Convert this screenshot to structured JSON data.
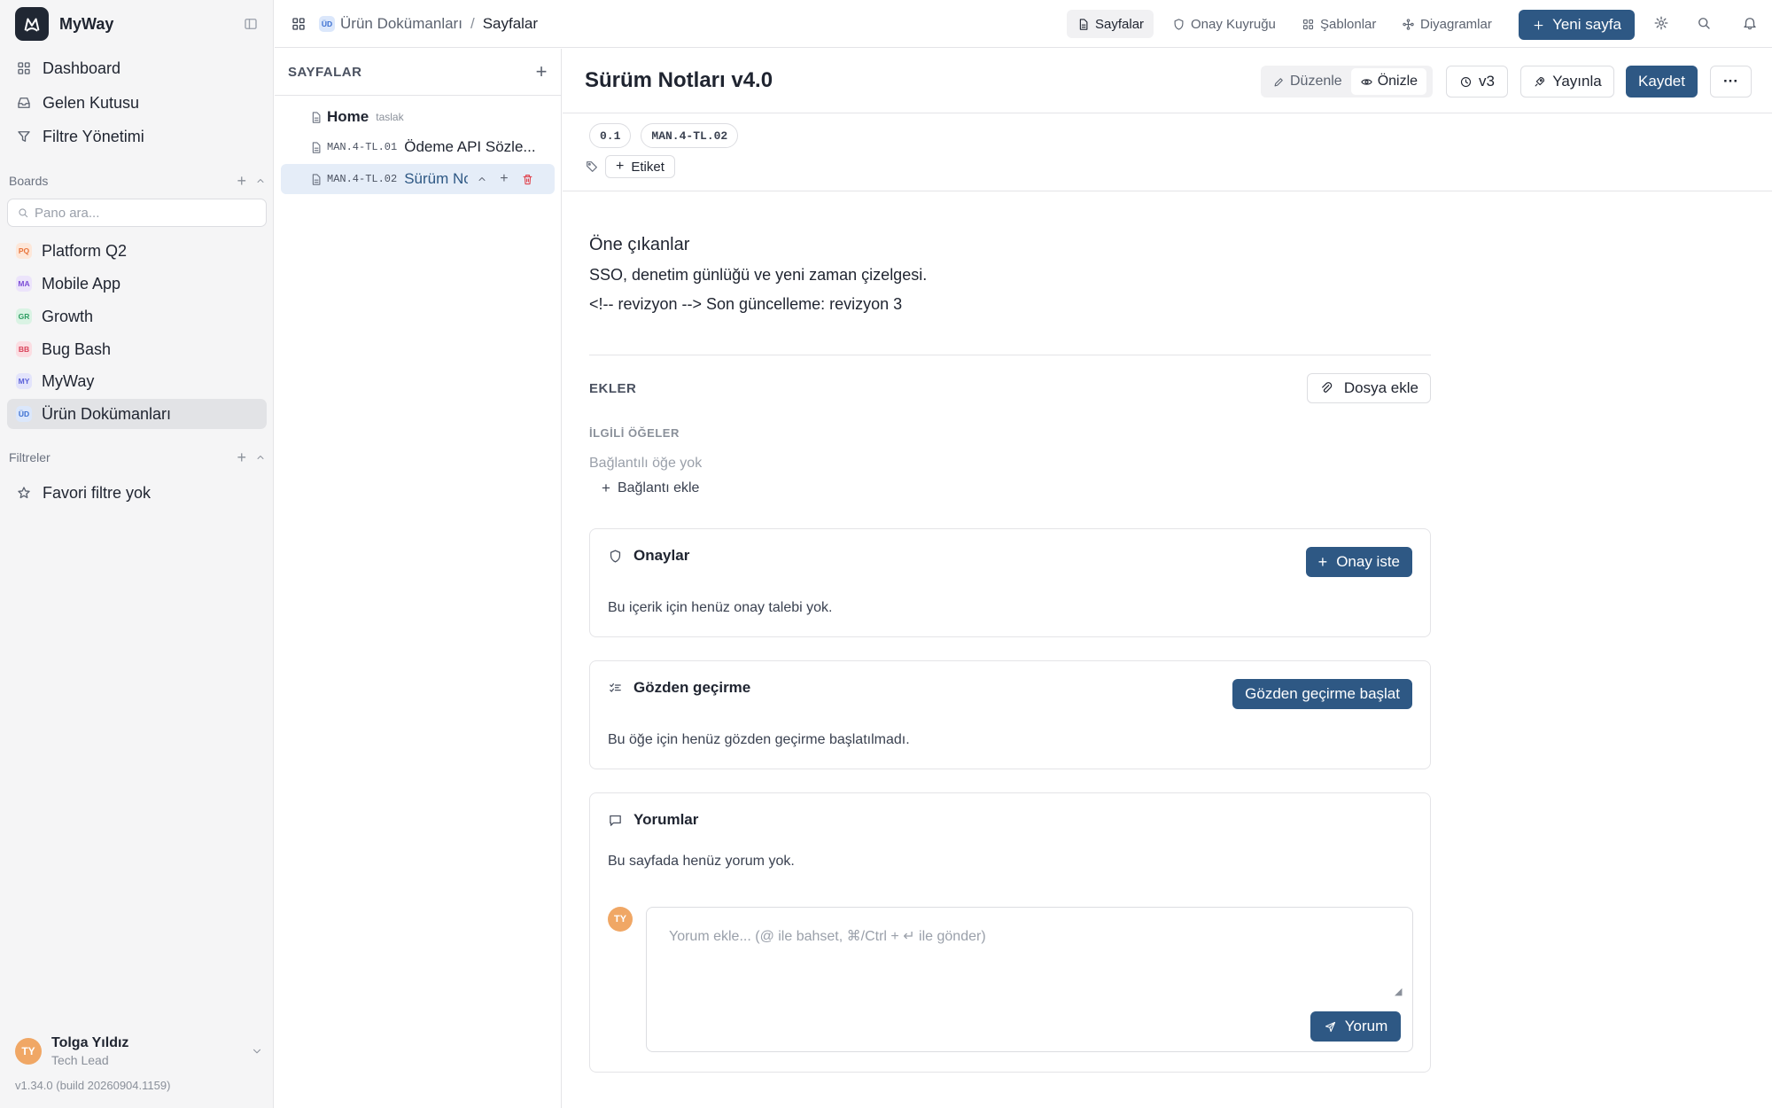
{
  "app": {
    "name": "MyWay",
    "version": "v1.34.0 (build 20260904.1159)"
  },
  "sidebar": {
    "nav": [
      {
        "label": "Dashboard",
        "icon": "dashboard-icon"
      },
      {
        "label": "Gelen Kutusu",
        "icon": "inbox-icon"
      },
      {
        "label": "Filtre Yönetimi",
        "icon": "filter-icon"
      }
    ],
    "boards_heading": "Boards",
    "board_search_placeholder": "Pano ara...",
    "boards": [
      {
        "badge": "PQ",
        "label": "Platform Q2",
        "color": "#e8743b",
        "bg": "#fde7d9"
      },
      {
        "badge": "MA",
        "label": "Mobile App",
        "color": "#7c4dd6",
        "bg": "#ece4fb"
      },
      {
        "badge": "GR",
        "label": "Growth",
        "color": "#2f9e63",
        "bg": "#daf3e4"
      },
      {
        "badge": "BB",
        "label": "Bug Bash",
        "color": "#d9435a",
        "bg": "#fbdde2"
      },
      {
        "badge": "MY",
        "label": "MyWay",
        "color": "#5b61d9",
        "bg": "#e3e4fb"
      },
      {
        "badge": "ÜD",
        "label": "Ürün Dokümanları",
        "color": "#3b6fd1",
        "bg": "#dbe7fb",
        "active": true
      }
    ],
    "filters_heading": "Filtreler",
    "filters_empty": "Favori filtre yok",
    "user": {
      "initials": "TY",
      "name": "Tolga Yıldız",
      "role": "Tech Lead"
    }
  },
  "topbar": {
    "breadcrumb": {
      "badge": "ÜD",
      "space": "Ürün Dokümanları",
      "separator": "/",
      "current": "Sayfalar"
    },
    "nav": [
      {
        "label": "Sayfalar",
        "active": true
      },
      {
        "label": "Onay Kuyruğu"
      },
      {
        "label": "Şablonlar"
      },
      {
        "label": "Diyagramlar"
      }
    ],
    "new_page": "Yeni sayfa"
  },
  "pages_panel": {
    "heading": "SAYFALAR",
    "items": [
      {
        "code": "",
        "title": "Home",
        "tag": "taslak"
      },
      {
        "code": "MAN.4-TL.01",
        "title": "Ödeme API Sözle..."
      },
      {
        "code": "MAN.4-TL.02",
        "title": "Sürüm No",
        "active": true
      }
    ]
  },
  "page": {
    "title": "Sürüm Notları v4.0",
    "edit": "Düzenle",
    "preview": "Önizle",
    "version_btn": "v3",
    "publish": "Yayınla",
    "save": "Kaydet",
    "more": "···",
    "chips": [
      "0.1",
      "MAN.4-TL.02"
    ],
    "tag_button": "Etiket",
    "content": {
      "heading": "Öne çıkanlar",
      "paragraph": "SSO, denetim günlüğü ve yeni zaman çizelgesi.",
      "revision": "<!-- revizyon --> Son güncelleme: revizyon 3"
    },
    "attachments": {
      "label": "EKLER",
      "button": "Dosya ekle"
    },
    "related": {
      "label": "İLGİLİ ÖĞELER",
      "empty": "Bağlantılı öğe yok",
      "add": "Bağlantı ekle"
    },
    "approvals": {
      "title": "Onaylar",
      "button": "Onay iste",
      "empty": "Bu içerik için henüz onay talebi yok."
    },
    "review": {
      "title": "Gözden geçirme",
      "button": "Gözden geçirme başlat",
      "empty": "Bu öğe için henüz gözden geçirme başlatılmadı."
    },
    "comments": {
      "title": "Yorumlar",
      "empty": "Bu sayfada henüz yorum yok.",
      "avatar": "TY",
      "placeholder": "Yorum ekle... (@ ile bahset, ⌘/Ctrl + ↵ ile gönder)",
      "submit": "Yorum"
    }
  }
}
